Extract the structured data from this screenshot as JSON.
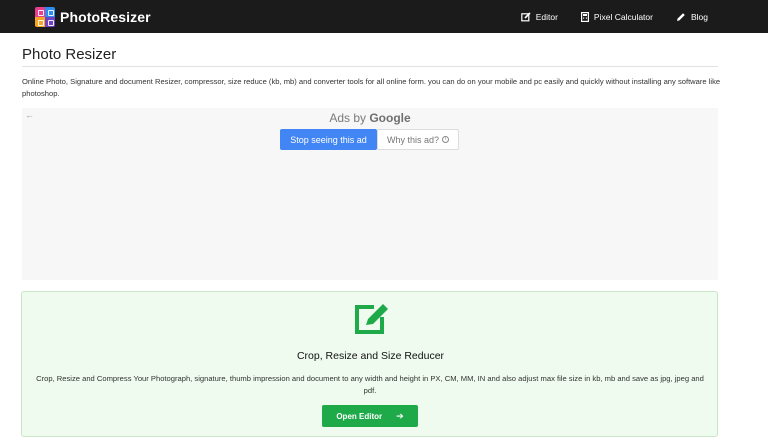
{
  "navbar": {
    "brand": "PhotoResizer",
    "links": [
      {
        "label": "Editor",
        "icon": "edit-icon"
      },
      {
        "label": "Pixel Calculator",
        "icon": "calculator-icon"
      },
      {
        "label": "Blog",
        "icon": "pencil-icon"
      }
    ]
  },
  "page": {
    "title": "Photo Resizer",
    "intro": "Online Photo, Signature and document Resizer, compressor, size reduce (kb, mb) and converter tools for all online form. you can do on your mobile and pc easily and quickly without installing any software like photoshop."
  },
  "ad": {
    "back_arrow": "←",
    "ads_by": "Ads by",
    "google": "Google",
    "stop_label": "Stop seeing this ad",
    "why_label": "Why this ad?",
    "info_glyph": "i"
  },
  "card": {
    "icon": "edit-icon",
    "title": "Crop, Resize and Size Reducer",
    "description": "Crop, Resize and Compress Your Photograph, signature, thumb impression and document to any width and height in PX, CM, MM, IN and also adjust max file size in kb, mb and save as jpg, jpeg and pdf.",
    "button_label": "Open Editor",
    "button_arrow": "➔",
    "accent": "#1faa4a"
  }
}
